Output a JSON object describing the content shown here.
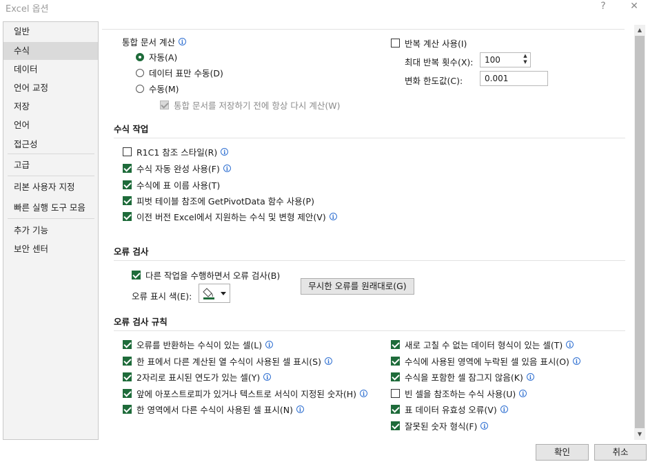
{
  "window": {
    "title": "Excel 옵션",
    "help": "?",
    "close": "✕"
  },
  "sidebar": {
    "items": [
      "일반",
      "수식",
      "데이터",
      "언어 교정",
      "저장",
      "언어",
      "접근성",
      "고급",
      "리본 사용자 지정",
      "빠른 실행 도구 모음",
      "추가 기능",
      "보안 센터"
    ],
    "selected": "수식"
  },
  "calc": {
    "title": "통합 문서 계산",
    "auto": "자동(A)",
    "auto_except_tables": "데이터 표만 수동(D)",
    "manual": "수동(M)",
    "recalc_before_save": "통합 문서를 저장하기 전에 항상 다시 계산(W)",
    "iterative": "반복 계산 사용(I)",
    "max_iter_label": "최대 반복 횟수(X):",
    "max_iter_value": "100",
    "max_change_label": "변화 한도값(C):",
    "max_change_value": "0.001"
  },
  "formulas": {
    "title": "수식 작업",
    "r1c1": "R1C1 참조 스타일(R)",
    "autocomplete": "수식 자동 완성 사용(F)",
    "table_names": "수식에 표 이름 사용(T)",
    "getpivotdata": "피벗 테이블 참조에 GetPivotData 함수 사용(P)",
    "legacy_suggest": "이전 버전 Excel에서 지원하는 수식 및 변형 제안(V)"
  },
  "errcheck": {
    "title": "오류 검사",
    "background": "다른 작업을 수행하면서 오류 검사(B)",
    "color_label": "오류 표시 색(E):",
    "reset_button": "무시한 오류를 원래대로(G)"
  },
  "rules": {
    "title": "오류 검사 규칙",
    "left": [
      {
        "label": "오류를 반환하는 수식이 있는 셀(L)",
        "checked": true
      },
      {
        "label": "한 표에서 다른 계산된 열 수식이 사용된 셀 표시(S)",
        "checked": true
      },
      {
        "label": "2자리로 표시된 연도가 있는 셀(Y)",
        "checked": true
      },
      {
        "label": "앞에 아포스트로피가 있거나 텍스트로 서식이 지정된 숫자(H)",
        "checked": true
      },
      {
        "label": "한 영역에서 다른 수식이 사용된 셀 표시(N)",
        "checked": true
      }
    ],
    "right": [
      {
        "label": "새로 고칠 수 없는 데이터 형식이 있는 셀(T)",
        "checked": true
      },
      {
        "label": "수식에 사용된 영역에 누락된 셀 있음 표시(O)",
        "checked": true
      },
      {
        "label": "수식을 포함한 셀 잠그지 않음(K)",
        "checked": true
      },
      {
        "label": "빈 셀을 참조하는 수식 사용(U)",
        "checked": false
      },
      {
        "label": "표 데이터 유효성 오류(V)",
        "checked": true
      },
      {
        "label": "잘못된 숫자 형식(F)",
        "checked": true
      }
    ]
  },
  "footer": {
    "ok": "확인",
    "cancel": "취소"
  },
  "colors": {
    "accent": "#1e6b3a",
    "info": "#2e6fd1"
  }
}
